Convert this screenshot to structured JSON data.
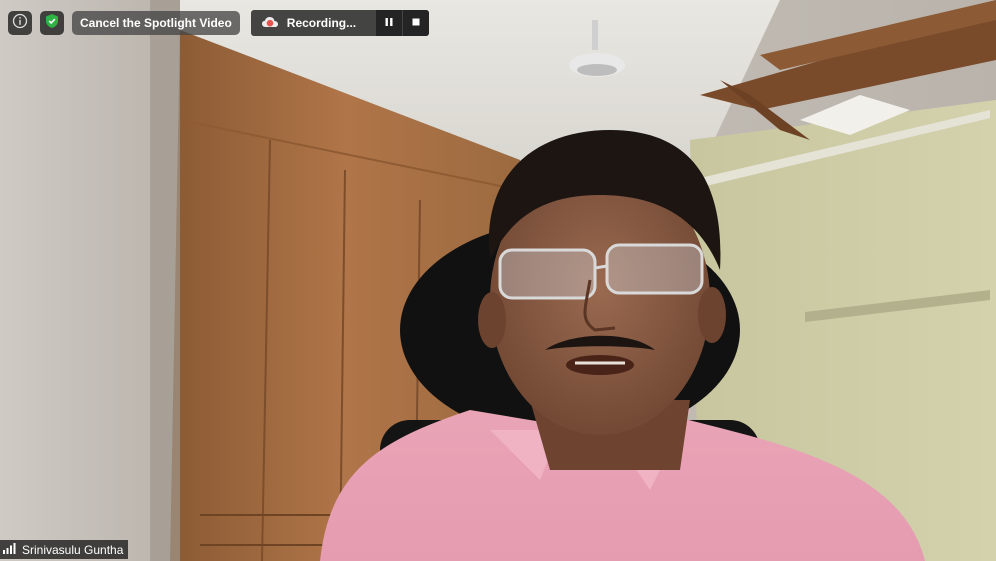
{
  "toolbar": {
    "info_icon": "info-icon",
    "security_icon": "shield-check-icon",
    "cancel_spotlight_label": "Cancel the Spotlight Video",
    "security_color": "#2fb344"
  },
  "recording": {
    "label": "Recording...",
    "cloud_icon": "cloud-icon",
    "cloud_color": "#e8554e",
    "pause_icon": "pause-icon",
    "stop_icon": "stop-icon"
  },
  "participant": {
    "name": "Srinivasulu Guntha",
    "signal_icon": "signal-bars-icon"
  }
}
